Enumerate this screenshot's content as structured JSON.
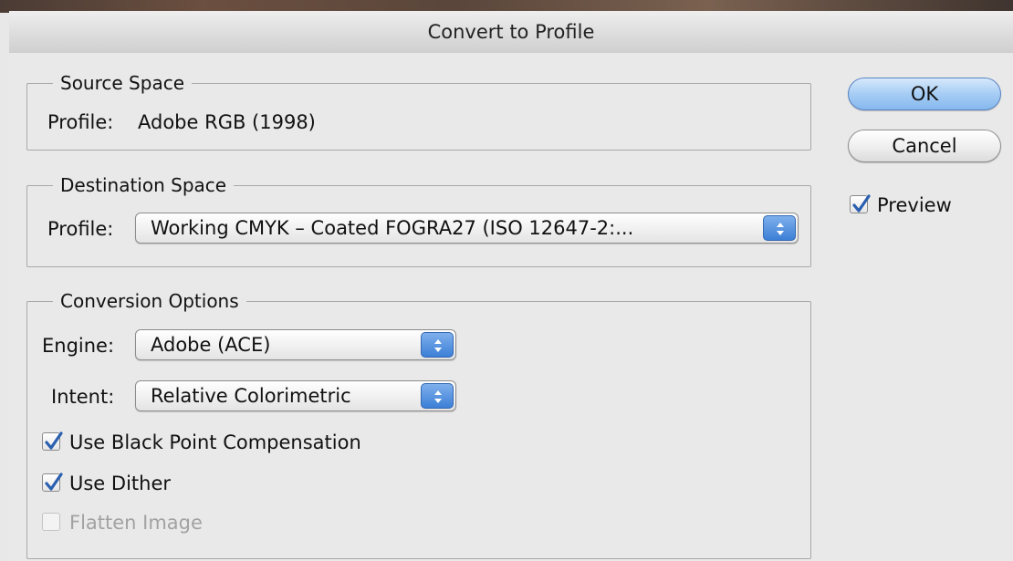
{
  "dialog": {
    "title": "Convert to Profile"
  },
  "source_space": {
    "legend": "Source Space",
    "profile_label": "Profile:",
    "profile_value": "Adobe RGB (1998)"
  },
  "destination_space": {
    "legend": "Destination Space",
    "profile_label": "Profile:",
    "profile_selected": "Working CMYK – Coated FOGRA27 (ISO 12647-2:..."
  },
  "conversion_options": {
    "legend": "Conversion Options",
    "engine_label": "Engine:",
    "engine_selected": "Adobe (ACE)",
    "intent_label": "Intent:",
    "intent_selected": "Relative Colorimetric",
    "checkboxes": [
      {
        "label": "Use Black Point Compensation",
        "checked": true,
        "enabled": true
      },
      {
        "label": "Use Dither",
        "checked": true,
        "enabled": true
      },
      {
        "label": "Flatten Image",
        "checked": false,
        "enabled": false
      }
    ]
  },
  "buttons": {
    "ok": "OK",
    "cancel": "Cancel"
  },
  "preview": {
    "label": "Preview",
    "checked": true
  },
  "colors": {
    "accent": "#3c7fd6",
    "checkmark": "#2a5fb0",
    "disabled_text": "#a2a2a2"
  },
  "icons": {
    "stepper": "up-down-arrows-icon",
    "checkmark": "checkmark-icon"
  }
}
